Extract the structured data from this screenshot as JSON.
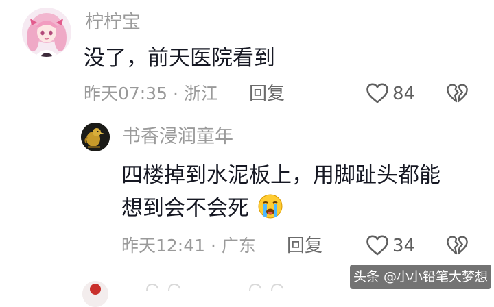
{
  "comments": [
    {
      "username": "柠柠宝",
      "content": "没了，前天医院看到",
      "meta": "昨天07:35 · 浙江",
      "reply_label": "回复",
      "like_count": "84"
    },
    {
      "username": "书香浸润童年",
      "content_line1": "四楼掉到水泥板上，用脚趾头都能",
      "content_line2": "想到会不会死",
      "emoji": "😭",
      "meta": "昨天12:41 · 广东",
      "reply_label": "回复",
      "like_count": "34"
    }
  ],
  "watermark": "头条 @小小铅笔大梦想",
  "icons": {
    "like": "heart-outline-icon",
    "dislike": "broken-heart-icon",
    "crying_emoji": "crying-face-emoji"
  },
  "colors": {
    "username": "#9a9a9a",
    "content": "#161823",
    "meta": "#9a9a9a",
    "background": "#ffffff"
  }
}
